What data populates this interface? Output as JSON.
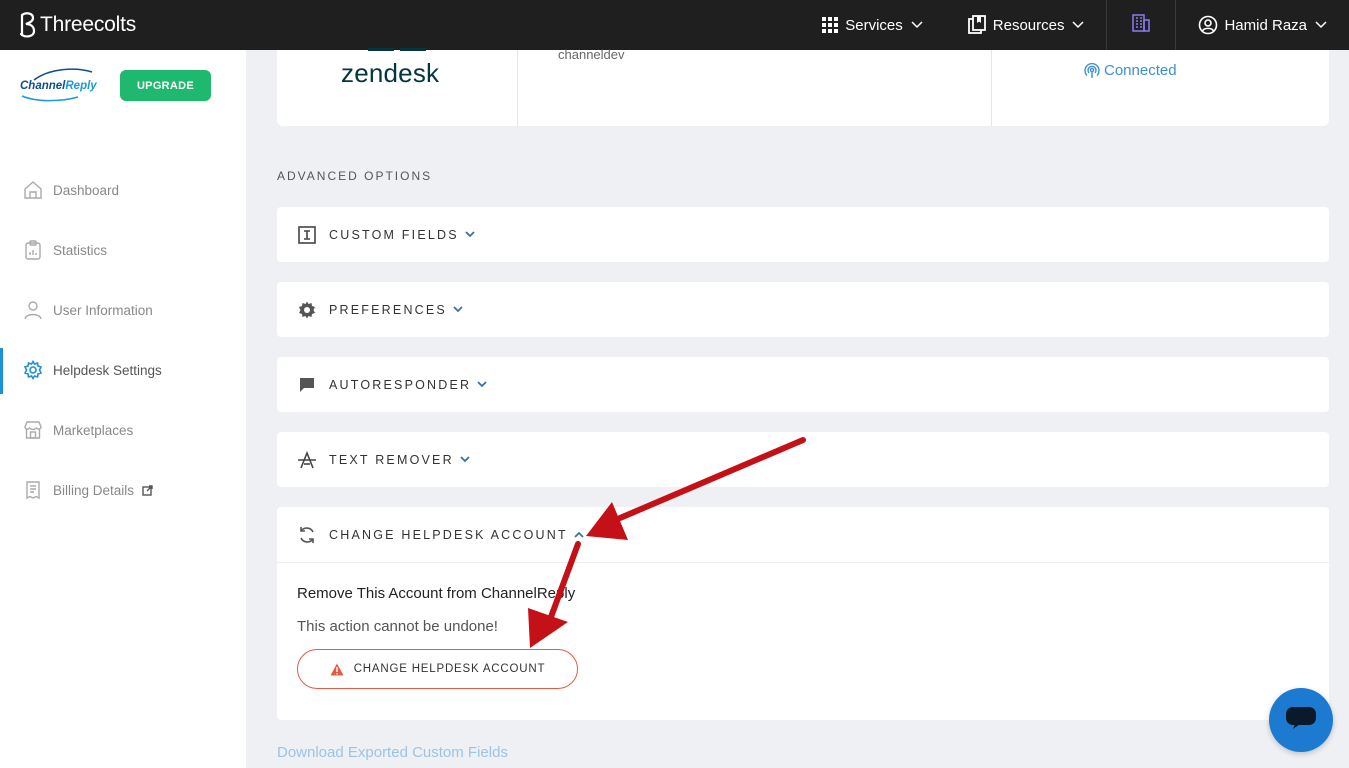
{
  "topbar": {
    "brand": "Threecolts",
    "services_label": "Services",
    "resources_label": "Resources",
    "user_name": "Hamid Raza"
  },
  "sidebar": {
    "logo_text_1": "Channel",
    "logo_text_2": "Reply",
    "upgrade_label": "UPGRADE",
    "items": [
      {
        "label": "Dashboard",
        "icon": "home-icon"
      },
      {
        "label": "Statistics",
        "icon": "clipboard-chart-icon"
      },
      {
        "label": "User Information",
        "icon": "user-icon"
      },
      {
        "label": "Helpdesk Settings",
        "icon": "gear-icon",
        "active": true
      },
      {
        "label": "Marketplaces",
        "icon": "store-icon"
      },
      {
        "label": "Billing Details",
        "icon": "receipt-icon"
      }
    ]
  },
  "account_card": {
    "helpdesk_logo_text": "zendesk",
    "account_name": "channeldev",
    "status": "Connected"
  },
  "advanced": {
    "section_label": "ADVANCED OPTIONS",
    "accordions": [
      {
        "title": "CUSTOM FIELDS",
        "icon": "text-cursor-icon"
      },
      {
        "title": "PREFERENCES",
        "icon": "gear-icon"
      },
      {
        "title": "AUTORESPONDER",
        "icon": "chat-icon"
      },
      {
        "title": "TEXT REMOVER",
        "icon": "strikethrough-a-icon"
      }
    ],
    "change_account": {
      "title": "CHANGE HELPDESK ACCOUNT",
      "remove_title": "Remove This Account from ChannelReply",
      "warning": "This action cannot be undone!",
      "button_label": "CHANGE HELPDESK ACCOUNT"
    }
  },
  "download_link": "Download Exported Custom Fields",
  "colors": {
    "topbar_bg": "#1f1f1f",
    "upgrade_green": "#1eb86f",
    "accent_blue": "#1e90d8",
    "danger": "#e45b42",
    "arrow_red": "#d9141b"
  }
}
